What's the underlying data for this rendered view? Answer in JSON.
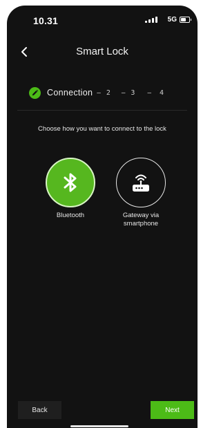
{
  "status_bar": {
    "time": "10.31",
    "network": "5G"
  },
  "header": {
    "title": "Smart Lock"
  },
  "stepper": {
    "active_label": "Connection",
    "steps": [
      {
        "dash": "–",
        "num": "2"
      },
      {
        "dash": "–",
        "num": "3"
      },
      {
        "dash": "–",
        "num": "4"
      }
    ]
  },
  "prompt": "Choose how you want to connect to the lock",
  "options": {
    "bluetooth": {
      "label": "Bluetooth"
    },
    "gateway": {
      "label_line1": "Gateway via",
      "label_line2": "smartphone"
    }
  },
  "footer": {
    "back_label": "Back",
    "next_label": "Next"
  },
  "colors": {
    "accent": "#4cbb17",
    "background": "#121212"
  }
}
